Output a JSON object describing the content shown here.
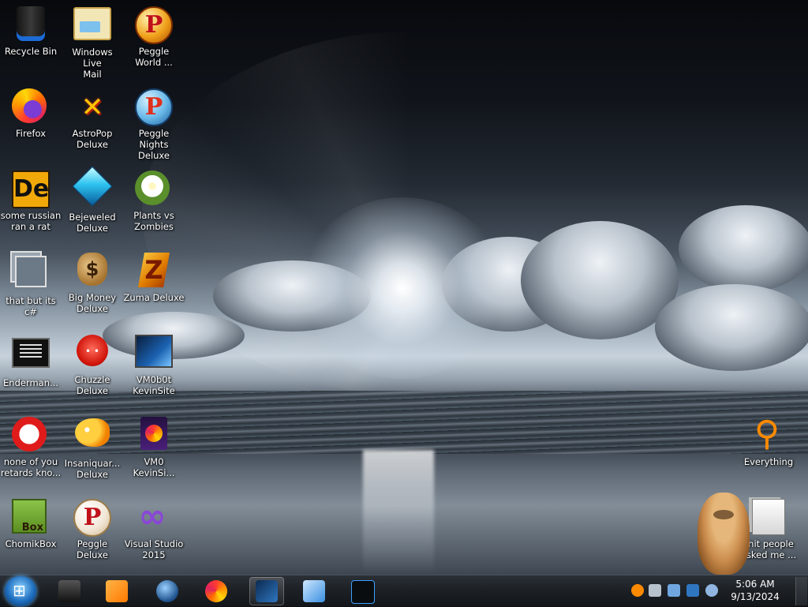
{
  "desktop": {
    "icons": [
      {
        "id": "recycle-bin",
        "line1": "Recycle Bin",
        "line2": ""
      },
      {
        "id": "windows-live-mail",
        "line1": "Windows Live",
        "line2": "Mail"
      },
      {
        "id": "peggle-world",
        "line1": "Peggle",
        "line2": "World ..."
      },
      {
        "id": "firefox",
        "line1": "Firefox",
        "line2": ""
      },
      {
        "id": "astropop",
        "line1": "AstroPop",
        "line2": "Deluxe"
      },
      {
        "id": "peggle-nights",
        "line1": "Peggle",
        "line2": "Nights Deluxe"
      },
      {
        "id": "russian-rat",
        "line1": "some russian",
        "line2": "ran a rat"
      },
      {
        "id": "bejeweled",
        "line1": "Bejeweled",
        "line2": "Deluxe"
      },
      {
        "id": "pvz",
        "line1": "Plants vs",
        "line2": "Zombies"
      },
      {
        "id": "that-but-csharp",
        "line1": "that but its",
        "line2": "c#"
      },
      {
        "id": "big-money",
        "line1": "Big Money",
        "line2": "Deluxe"
      },
      {
        "id": "zuma",
        "line1": "Zuma Deluxe",
        "line2": ""
      },
      {
        "id": "enderman",
        "line1": "Enderman...",
        "line2": ""
      },
      {
        "id": "chuzzle",
        "line1": "Chuzzle",
        "line2": "Deluxe"
      },
      {
        "id": "vm0b0t-kevinsite",
        "line1": "VM0b0t",
        "line2": "KevinSite"
      },
      {
        "id": "none-of-you",
        "line1": "none of you",
        "line2": "retards kno..."
      },
      {
        "id": "insaniquarium",
        "line1": "Insaniquar...",
        "line2": "Deluxe"
      },
      {
        "id": "vm0-kevinsi",
        "line1": "VM0",
        "line2": "KevinSi..."
      },
      {
        "id": "chomikbox",
        "line1": "ChomikBox",
        "line2": ""
      },
      {
        "id": "peggle-deluxe",
        "line1": "Peggle",
        "line2": "Deluxe"
      },
      {
        "id": "visual-studio",
        "line1": "Visual Studio",
        "line2": "2015"
      },
      {
        "id": "everything",
        "line1": "Everything",
        "line2": ""
      },
      {
        "id": "shit-people",
        "line1": "shit people",
        "line2": "asked me ..."
      }
    ],
    "chomikbox_text": "Box"
  },
  "taskbar": {
    "start_icon": "windows-orb-icon",
    "pinned": [
      {
        "name": "explorer-icon"
      },
      {
        "name": "media-player-icon"
      },
      {
        "name": "globe-icon"
      },
      {
        "name": "firefox-icon"
      },
      {
        "name": "vm-viewer-icon"
      },
      {
        "name": "remote-desktop-icon"
      },
      {
        "name": "resource-monitor-icon"
      }
    ],
    "tray": {
      "icons": [
        "everything-search-icon",
        "network-icon",
        "device-icon",
        "display-icon",
        "volume-icon"
      ],
      "time": "5:06 AM",
      "date": "9/13/2024"
    }
  },
  "colors": {
    "taskbar": "#1c2025",
    "label_text": "#ffffff",
    "everything_accent": "#ff8a00"
  }
}
